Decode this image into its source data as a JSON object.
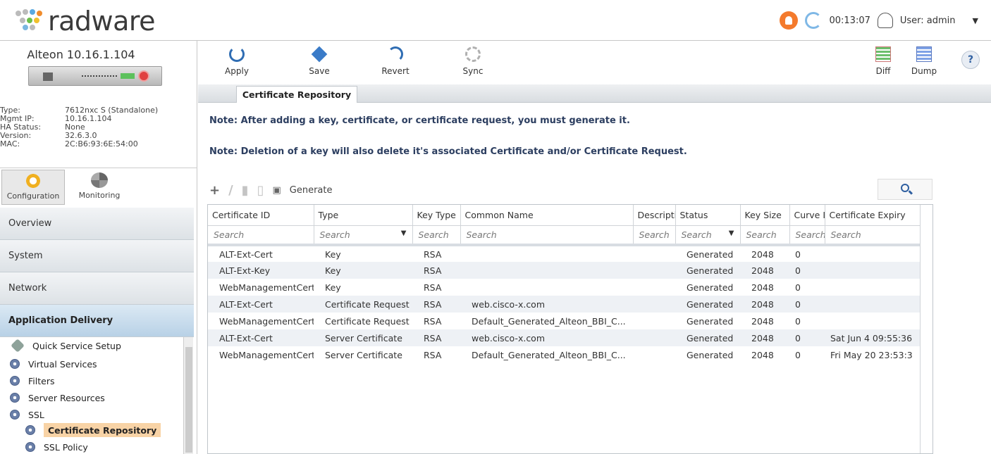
{
  "header": {
    "brand": "radware",
    "timer": "00:13:07",
    "user_label": "User: admin",
    "caret": "▼"
  },
  "device": {
    "title": "Alteon 10.16.1.104",
    "info": [
      {
        "k": "Type:",
        "v": "7612nxc S (Standalone)"
      },
      {
        "k": "Mgmt IP:",
        "v": "10.16.1.104"
      },
      {
        "k": "HA Status:",
        "v": "None"
      },
      {
        "k": "Version:",
        "v": "32.6.3.0"
      },
      {
        "k": "MAC:",
        "v": "2C:B6:93:6E:54:00"
      }
    ]
  },
  "mode_tabs": {
    "configuration": "Configuration",
    "monitoring": "Monitoring"
  },
  "nav": [
    "Overview",
    "System",
    "Network",
    "Application Delivery"
  ],
  "tree": {
    "quick": "Quick Service Setup",
    "virtual": "Virtual Services",
    "filters": "Filters",
    "server": "Server Resources",
    "ssl": "SSL",
    "cert": "Certificate Repository",
    "policy": "SSL Policy"
  },
  "toolbar": {
    "apply": "Apply",
    "save": "Save",
    "revert": "Revert",
    "sync": "Sync",
    "diff": "Diff",
    "dump": "Dump",
    "help": "?"
  },
  "tab": "Certificate Repository",
  "notes": {
    "n1": "Note: After adding a key, certificate, or certificate request, you must generate it.",
    "n2": "Note: Deletion of a key will also delete it's associated Certificate and/or Certificate Request."
  },
  "actions": {
    "generate": "Generate"
  },
  "table": {
    "headers": [
      "Certificate ID",
      "Type",
      "Key Type",
      "Common Name",
      "Descripti",
      "Status",
      "Key Size",
      "Curve I",
      "Certificate Expiry"
    ],
    "filters": [
      "Search",
      "Search",
      "Search",
      "Search",
      "Search",
      "Search",
      "Search",
      "Search",
      "Search"
    ],
    "rows": [
      [
        "ALT-Ext-Cert",
        "Key",
        "RSA",
        "",
        "",
        "Generated",
        "2048",
        "0",
        ""
      ],
      [
        "ALT-Ext-Key",
        "Key",
        "RSA",
        "",
        "",
        "Generated",
        "2048",
        "0",
        ""
      ],
      [
        "WebManagementCert",
        "Key",
        "RSA",
        "",
        "",
        "Generated",
        "2048",
        "0",
        ""
      ],
      [
        "ALT-Ext-Cert",
        "Certificate Request",
        "RSA",
        "web.cisco-x.com",
        "",
        "Generated",
        "2048",
        "0",
        ""
      ],
      [
        "WebManagementCert",
        "Certificate Request",
        "RSA",
        "Default_Generated_Alteon_BBI_C...",
        "",
        "Generated",
        "2048",
        "0",
        ""
      ],
      [
        "ALT-Ext-Cert",
        "Server Certificate",
        "RSA",
        "web.cisco-x.com",
        "",
        "Generated",
        "2048",
        "0",
        "Sat Jun 4 09:55:36"
      ],
      [
        "WebManagementCert",
        "Server Certificate",
        "RSA",
        "Default_Generated_Alteon_BBI_C...",
        "",
        "Generated",
        "2048",
        "0",
        "Fri May 20 23:53:3"
      ]
    ]
  },
  "colors": {
    "accent": "#2f6db3",
    "alert": "#f47a2c",
    "selected_tree": "#f8d3a6"
  }
}
